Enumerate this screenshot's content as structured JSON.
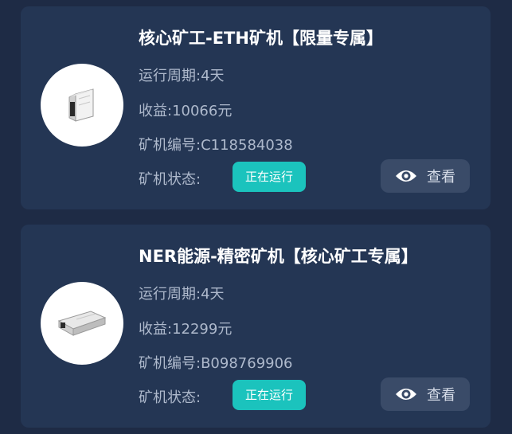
{
  "cards": [
    {
      "title": "核心矿工-ETH矿机【限量专属】",
      "image_icon": "mining-rig-icon",
      "period_label": "运行周期:",
      "period_value": "4天",
      "income_label": "收益:",
      "income_value": "10066元",
      "id_label": "矿机编号:",
      "id_value": "C118584038",
      "status_label": "矿机状态:",
      "status_badge": "正在运行",
      "view_label": "查看",
      "view_icon": "eye-icon"
    },
    {
      "title": "NER能源-精密矿机【核心矿工专属】",
      "image_icon": "mining-rig-icon",
      "period_label": "运行周期:",
      "period_value": "4天",
      "income_label": "收益:",
      "income_value": "12299元",
      "id_label": "矿机编号:",
      "id_value": "B098769906",
      "status_label": "矿机状态:",
      "status_badge": "正在运行",
      "view_label": "查看",
      "view_icon": "eye-icon"
    }
  ],
  "colors": {
    "background": "#1e2b45",
    "card": "#243654",
    "status_badge": "#1bc3bd",
    "view_button": "#3a4b68"
  }
}
